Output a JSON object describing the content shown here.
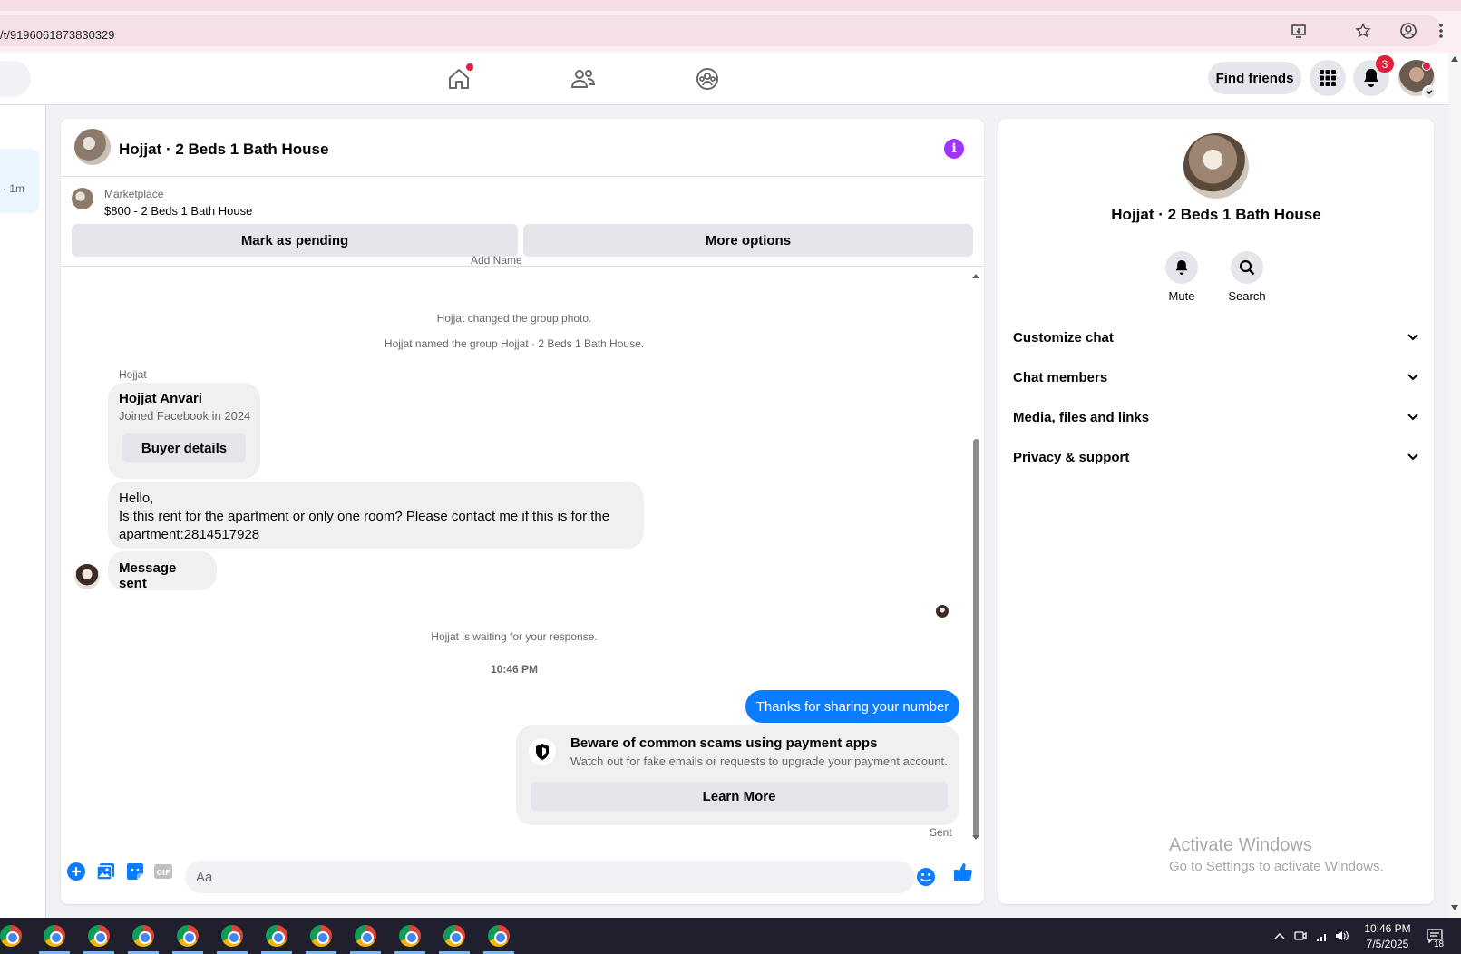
{
  "browser": {
    "url": "/t/9196061873830329"
  },
  "nav": {
    "find_friends": "Find friends",
    "notification_count": "3"
  },
  "left": {
    "time": "· 1m"
  },
  "chat": {
    "title": "Hojjat · 2 Beds 1 Bath House",
    "marketplace_label": "Marketplace",
    "listing": "$800 - 2 Beds 1 Bath House",
    "mark_pending": "Mark as pending",
    "more_options": "More options",
    "cut_text": "Add          Name",
    "note_photo": "Hojjat changed the group photo.",
    "note_named": "Hojjat named the group Hojjat · 2 Beds 1 Bath House.",
    "sender": "Hojjat",
    "buyer_name": "Hojjat Anvari",
    "buyer_joined": "Joined Facebook in 2024",
    "buyer_details": "Buyer details",
    "msg_line1": "Hello,",
    "msg_line2": "Is this rent for the apartment or only one room? Please contact me if this is for the apartment:2814517928",
    "msg_sent": "Message sent",
    "note_waiting": "Hojjat is waiting for your response.",
    "timestamp": "10:46 PM",
    "outgoing": "Thanks for sharing your number",
    "scam_title": "Beware of common scams using payment apps",
    "scam_desc": "Watch out for fake emails or requests to upgrade your payment account.",
    "learn_more": "Learn More",
    "status": "Sent",
    "composer_placeholder": "Aa"
  },
  "info": {
    "title": "Hojjat · 2 Beds 1 Bath House",
    "mute": "Mute",
    "search": "Search",
    "rows": [
      "Customize chat",
      "Chat members",
      "Media, files and links",
      "Privacy & support"
    ],
    "activate_title": "Activate Windows",
    "activate_sub": "Go to Settings to activate Windows."
  },
  "taskbar": {
    "time": "10:46 PM",
    "date": "7/5/2025",
    "notif": "18"
  },
  "colors": {
    "accent": "#0a7cff",
    "info": "#a033ff",
    "badge": "#e41e3f"
  }
}
